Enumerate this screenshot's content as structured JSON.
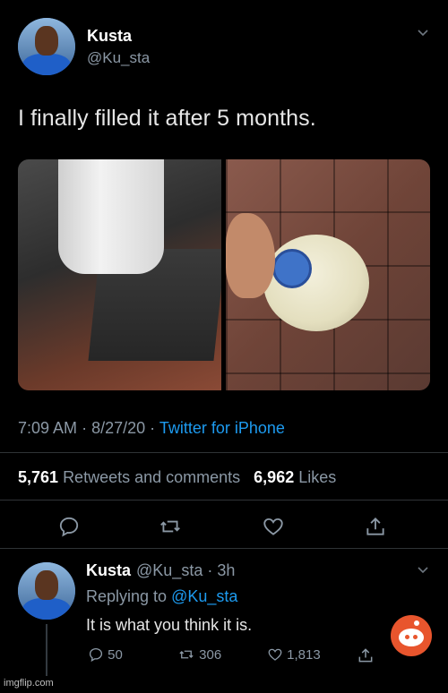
{
  "tweet": {
    "author_name": "Kusta",
    "author_handle": "@Ku_sta",
    "text": "I finally filled it after 5 months.",
    "time": "7:09 AM",
    "date": "8/27/20",
    "source": "Twitter for iPhone",
    "retweets_count": "5,761",
    "retweets_label": "Retweets and comments",
    "likes_count": "6,962",
    "likes_label": "Likes"
  },
  "actions": {
    "reply_icon": "reply-icon",
    "retweet_icon": "retweet-icon",
    "like_icon": "heart-icon",
    "share_icon": "share-icon"
  },
  "reply": {
    "author_name": "Kusta",
    "author_handle": "@Ku_sta",
    "time_ago": "3h",
    "replying_prefix": "Replying to",
    "replying_to": "@Ku_sta",
    "text": "It is what you think it is.",
    "reply_count": "50",
    "retweet_count": "306",
    "like_count": "1,813"
  },
  "watermark": "imgflip.com",
  "colors": {
    "background": "#000000",
    "accent": "#1d9bf0",
    "muted": "#8b98a5",
    "reddit": "#e8552d"
  }
}
